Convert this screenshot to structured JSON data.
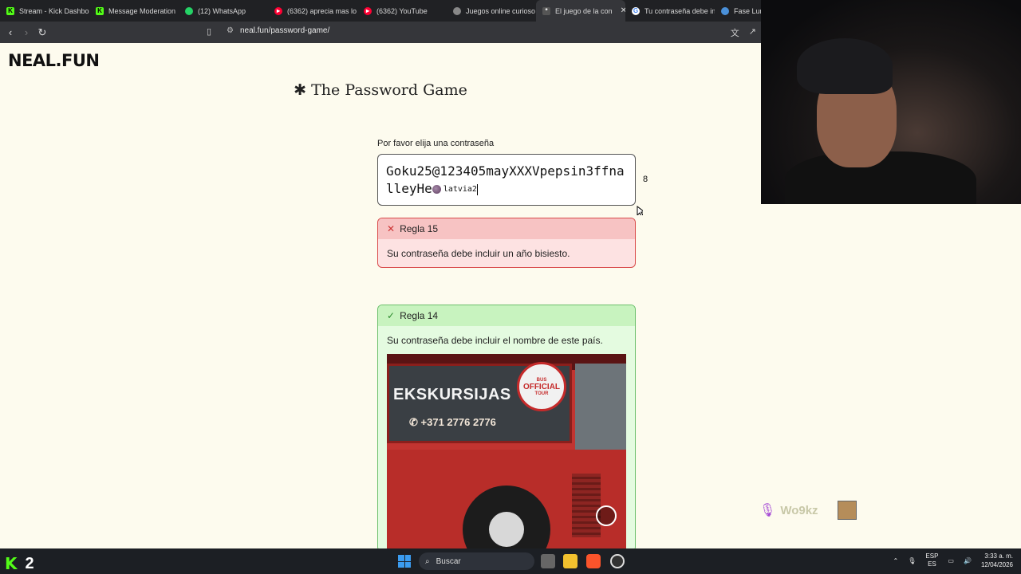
{
  "browser": {
    "tabs": [
      {
        "label": "Stream - Kick Dashbo",
        "icon": "kick-icon",
        "color": "#53fc18"
      },
      {
        "label": "Message Moderation",
        "icon": "kick-icon",
        "color": "#53fc18"
      },
      {
        "label": "(12) WhatsApp",
        "icon": "whatsapp-icon",
        "color": "#25d366"
      },
      {
        "label": "(6362) aprecia mas lo",
        "icon": "youtube-icon",
        "color": "#ff0033"
      },
      {
        "label": "(6362) YouTube",
        "icon": "youtube-icon",
        "color": "#ff0033"
      },
      {
        "label": "Juegos online curioso",
        "icon": "neal-icon",
        "color": "#888888"
      },
      {
        "label": "El juego de la con",
        "icon": "neal-icon",
        "color": "#555555",
        "active": true
      },
      {
        "label": "Tu contraseña debe in",
        "icon": "google-icon",
        "color": "#4285f4"
      },
      {
        "label": "Fase Luna",
        "icon": "globe-icon",
        "color": "#4a90d9"
      }
    ],
    "url": "neal.fun/password-game/"
  },
  "page": {
    "logo": "NEAL.FUN",
    "title": "The Password Game",
    "prompt": "Por favor elija una contraseña",
    "password_text": "Goku25@123405mayXXXVpepsin3ffnalleyHe",
    "password_chip": "latvia2",
    "char_count": "8"
  },
  "rules": [
    {
      "label": "Regla 15",
      "text": "Su contraseña debe incluir un año bisiesto.",
      "status": "fail"
    },
    {
      "label": "Regla 14",
      "text": "Su contraseña debe incluir el nombre de este país.",
      "status": "ok"
    }
  ],
  "photo": {
    "sign_text": "EKSKURSIJAS",
    "phone_text": "+371 2776 2776",
    "badge_top": "BUS",
    "badge_main": "OFFICIAL",
    "badge_bottom": "TOUR"
  },
  "overlay": {
    "chat_name": "Wo9kz"
  },
  "taskbar": {
    "kick_count": "2",
    "search_placeholder": "Buscar",
    "lang_top": "ESP",
    "lang_bottom": "ES",
    "time": "3:33 a. m.",
    "date": "12/04/2026"
  },
  "colors": {
    "page_bg": "#fdfbee",
    "fail_border": "#d94a4a",
    "ok_border": "#6cc06c",
    "kick_green": "#53fc18"
  }
}
